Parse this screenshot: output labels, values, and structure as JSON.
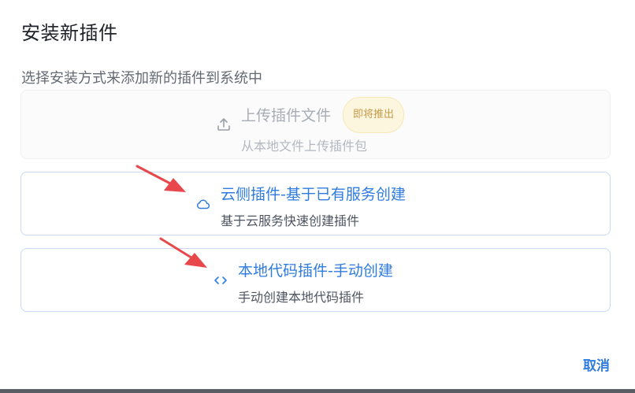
{
  "dialog": {
    "title": "安装新插件",
    "subtitle": "选择安装方式来添加新的插件到系统中",
    "options": {
      "upload": {
        "icon": "upload-icon",
        "title": "上传插件文件",
        "badge": "即将推出",
        "description": "从本地文件上传插件包",
        "disabled": true
      },
      "cloud": {
        "icon": "cloud-icon",
        "title": "云侧插件-基于已有服务创建",
        "description": "基于云服务快速创建插件"
      },
      "local": {
        "icon": "code-icon",
        "title": "本地代码插件-手动创建",
        "description": "手动创建本地代码插件"
      }
    },
    "cancel_label": "取消"
  },
  "colors": {
    "accent": "#2f7ce0",
    "arrow": "#e8484c",
    "badge_bg": "#fdf6df",
    "badge_text": "#c59a4a",
    "border": "#c9d8f3"
  }
}
